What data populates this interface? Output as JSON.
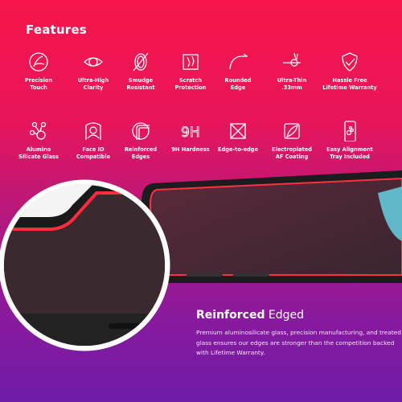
{
  "title": "Features",
  "features_row1": [
    {
      "icon": "precision-touch-icon",
      "label": "Precision\nTouch"
    },
    {
      "icon": "eye-icon",
      "label": "Ultra-High\nClarity"
    },
    {
      "icon": "fingerprint-icon",
      "label": "Smudge\nResistant"
    },
    {
      "icon": "scratch-icon",
      "label": "Scratch\nProtection"
    },
    {
      "icon": "rounded-edge-icon",
      "label": "Rounded\nEdge"
    },
    {
      "icon": "thin-icon",
      "label": "Ultra-Thin\n.33mm"
    },
    {
      "icon": "shield-check-icon",
      "label": "Hassle Free\nLifetime Warranty"
    }
  ],
  "features_row2": [
    {
      "icon": "molecule-icon",
      "label": "Alumino\nSilicate Glass"
    },
    {
      "icon": "face-id-icon",
      "label": "Face ID\nCompatible"
    },
    {
      "icon": "reinforced-edge-icon",
      "label": "Reinforced\nEdges"
    },
    {
      "icon": "9h-icon",
      "label": "9H Hardness"
    },
    {
      "icon": "edge-to-edge-icon",
      "label": "Edge-to-edge"
    },
    {
      "icon": "coating-icon",
      "label": "Electroplated\nAF Coating"
    },
    {
      "icon": "phone-tray-icon",
      "label": "Easy Alignment\nTray Included"
    }
  ],
  "headline": {
    "bold": "Reinforced",
    "light": " Edged"
  },
  "description": "Premium aluminosilicate glass, precision manufacturing, and treated glass ensures our edges are stronger than the competition backed with Lifetime Warranty.",
  "colors": {
    "top": "#f7154a",
    "bottom": "#6e1ca8",
    "glow": "#ff2a3c"
  }
}
